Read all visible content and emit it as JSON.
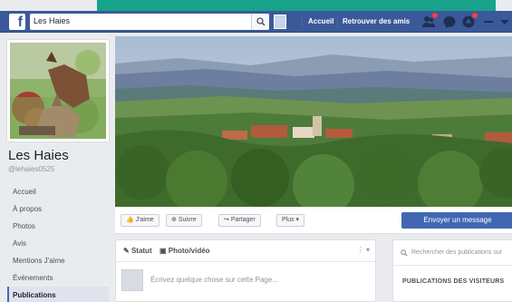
{
  "colors": {
    "facebook_blue": "#3b5998",
    "teal_banner": "#16a38a",
    "cta_blue": "#4267b2",
    "page_bg": "#e9ebee"
  },
  "topbar": {
    "search_value": "Les Haies",
    "user_name": "",
    "nav": [
      "Accueil",
      "Retrouver des amis"
    ],
    "icons": [
      "friends-icon",
      "messages-icon",
      "notifications-icon",
      "help-icon",
      "account-menu-icon"
    ]
  },
  "page": {
    "name": "Les Haies",
    "handle": "@lehaies0525"
  },
  "side_nav": [
    "Accueil",
    "À propos",
    "Photos",
    "Avis",
    "Mentions J'aime",
    "Événements",
    "Publications"
  ],
  "side_nav_active": "Publications",
  "actions": {
    "like": "J'aime",
    "follow": "Suivre",
    "share": "Partager",
    "more": "Plus ▾",
    "cta": "Envoyer un message"
  },
  "composer": {
    "tab_status": "Statut",
    "tab_photo": "Photo/vidéo",
    "placeholder": "Écrivez quelque chose sur cette Page..."
  },
  "right": {
    "search_placeholder": "Rechercher des publications sur",
    "section_title": "PUBLICATIONS DES VISITEURS"
  }
}
